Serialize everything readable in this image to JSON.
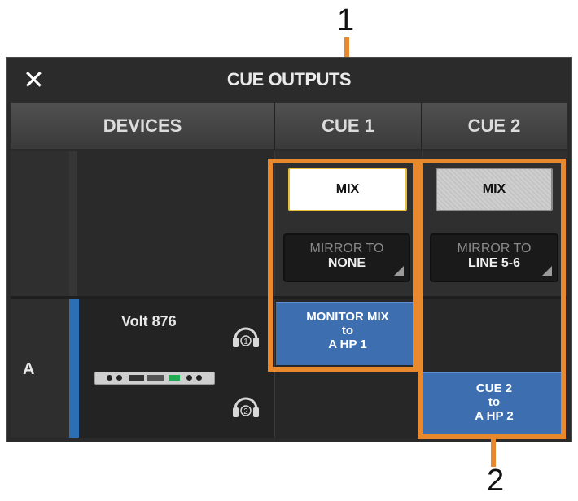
{
  "callouts": {
    "one": "1",
    "two": "2"
  },
  "window": {
    "title": "CUE OUTPUTS",
    "close_icon": "close-icon"
  },
  "columns": {
    "devices": "DEVICES",
    "cue1": "CUE 1",
    "cue2": "CUE 2"
  },
  "cue1": {
    "mix_label": "MIX",
    "mirror_label": "MIRROR TO",
    "mirror_value": "NONE",
    "route_line1": "MONITOR MIX",
    "route_line2": "to",
    "route_line3": "A HP 1"
  },
  "cue2": {
    "mix_label": "MIX",
    "mirror_label": "MIRROR TO",
    "mirror_value": "LINE 5-6",
    "route_line1": "CUE 2",
    "route_line2": "to",
    "route_line3": "A HP 2"
  },
  "device": {
    "letter": "A",
    "name": "Volt 876",
    "hp1": "1",
    "hp2": "2"
  },
  "colors": {
    "accent": "#e8892e",
    "route_blue": "#3d6fb0",
    "device_bar": "#2d6fb5",
    "mix_selected_border": "#e8c03c"
  }
}
